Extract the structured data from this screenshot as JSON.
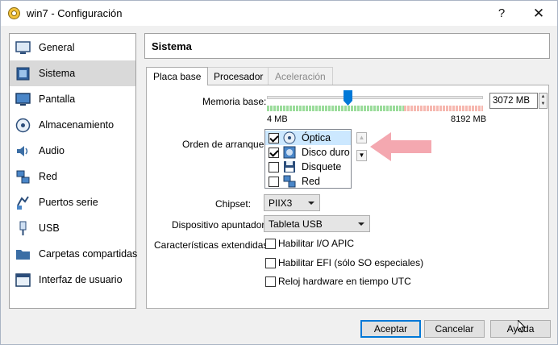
{
  "window": {
    "title": "win7 - Configuración",
    "help": "?",
    "close": "✕"
  },
  "sidebar": {
    "items": [
      {
        "label": "General",
        "icon": "monitor-icon"
      },
      {
        "label": "Sistema",
        "icon": "chip-icon",
        "selected": true
      },
      {
        "label": "Pantalla",
        "icon": "display-icon"
      },
      {
        "label": "Almacenamiento",
        "icon": "disk-icon"
      },
      {
        "label": "Audio",
        "icon": "speaker-icon"
      },
      {
        "label": "Red",
        "icon": "network-icon"
      },
      {
        "label": "Puertos serie",
        "icon": "serial-port-icon"
      },
      {
        "label": "USB",
        "icon": "usb-icon"
      },
      {
        "label": "Carpetas compartidas",
        "icon": "folder-icon"
      },
      {
        "label": "Interfaz de usuario",
        "icon": "ui-icon"
      }
    ]
  },
  "header": {
    "title": "Sistema"
  },
  "tabs": [
    {
      "label": "Placa base",
      "active": true
    },
    {
      "label": "Procesador"
    },
    {
      "label": "Aceleración",
      "disabled": true
    }
  ],
  "memory": {
    "label": "Memoria base:",
    "value": "3072 MB",
    "min_label": "4 MB",
    "max_label": "8192 MB",
    "slider_fraction": 0.375
  },
  "boot_order": {
    "label": "Orden de arranque:",
    "items": [
      {
        "label": "Óptica",
        "checked": true,
        "selected": true,
        "icon": "optical-disc-icon"
      },
      {
        "label": "Disco duro",
        "checked": true,
        "icon": "hard-disk-icon"
      },
      {
        "label": "Disquete",
        "checked": false,
        "icon": "floppy-icon"
      },
      {
        "label": "Red",
        "checked": false,
        "icon": "network-icon"
      }
    ]
  },
  "chipset": {
    "label": "Chipset:",
    "value": "PIIX3"
  },
  "pointing": {
    "label": "Dispositivo apuntador:",
    "value": "Tableta USB"
  },
  "extended": {
    "label": "Características extendidas:",
    "options": [
      "Habilitar I/O APIC",
      "Habilitar EFI (sólo SO especiales)",
      "Reloj hardware en tiempo UTC"
    ]
  },
  "buttons": {
    "ok": "Aceptar",
    "cancel": "Cancelar",
    "help": "Ayuda"
  },
  "colors": {
    "accent": "#0078d7",
    "arrow": "#f4a8b0"
  }
}
